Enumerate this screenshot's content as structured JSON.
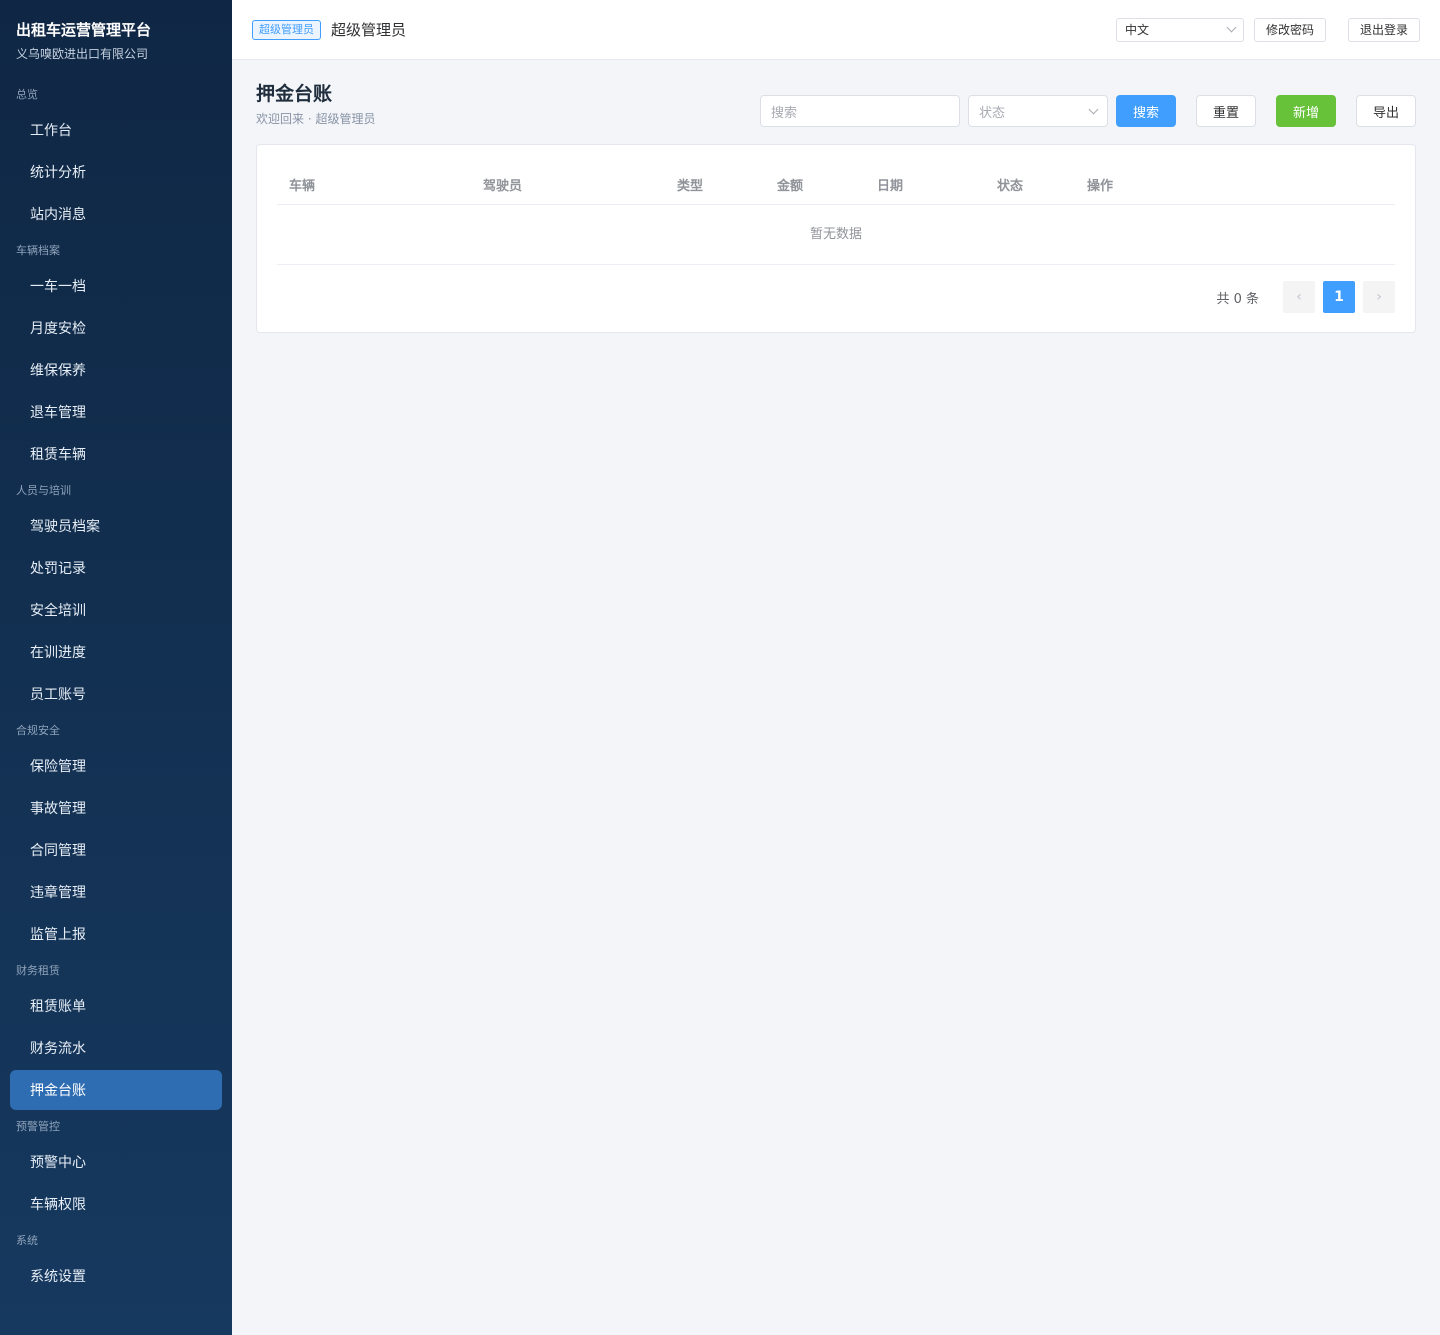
{
  "brand": {
    "title": "出租车运营管理平台",
    "subtitle": "义乌嗅欧进出口有限公司"
  },
  "sidebar": {
    "groups": [
      {
        "title": "总览",
        "items": [
          "工作台",
          "统计分析",
          "站内消息"
        ]
      },
      {
        "title": "车辆档案",
        "items": [
          "一车一档",
          "月度安检",
          "维保保养",
          "退车管理",
          "租赁车辆"
        ]
      },
      {
        "title": "人员与培训",
        "items": [
          "驾驶员档案",
          "处罚记录",
          "安全培训",
          "在训进度",
          "员工账号"
        ]
      },
      {
        "title": "合规安全",
        "items": [
          "保险管理",
          "事故管理",
          "合同管理",
          "违章管理",
          "监管上报"
        ]
      },
      {
        "title": "财务租赁",
        "items": [
          "租赁账单",
          "财务流水",
          "押金台账"
        ]
      },
      {
        "title": "预警管控",
        "items": [
          "预警中心",
          "车辆权限"
        ]
      },
      {
        "title": "系统",
        "items": [
          "系统设置"
        ]
      }
    ],
    "active": "押金台账"
  },
  "header": {
    "role_tag": "超级管理员",
    "user_name": "超级管理员",
    "language": "中文",
    "change_password": "修改密码",
    "logout": "退出登录"
  },
  "page": {
    "title": "押金台账",
    "subtitle": "欢迎回来 · 超级管理员",
    "search_placeholder": "搜索",
    "status_placeholder": "状态",
    "search_btn": "搜索",
    "reset_btn": "重置",
    "add_btn": "新增",
    "export_btn": "导出"
  },
  "table": {
    "columns": [
      "车辆",
      "驾驶员",
      "类型",
      "金额",
      "日期",
      "状态",
      "操作"
    ],
    "empty_text": "暂无数据"
  },
  "pagination": {
    "total_text": "共 0 条",
    "current_page": "1",
    "prev": "‹",
    "next": "›"
  },
  "colors": {
    "primary": "#409eff",
    "success": "#67c23a",
    "sidebar": "#0f2744",
    "active_nav": "#2f6db3"
  }
}
